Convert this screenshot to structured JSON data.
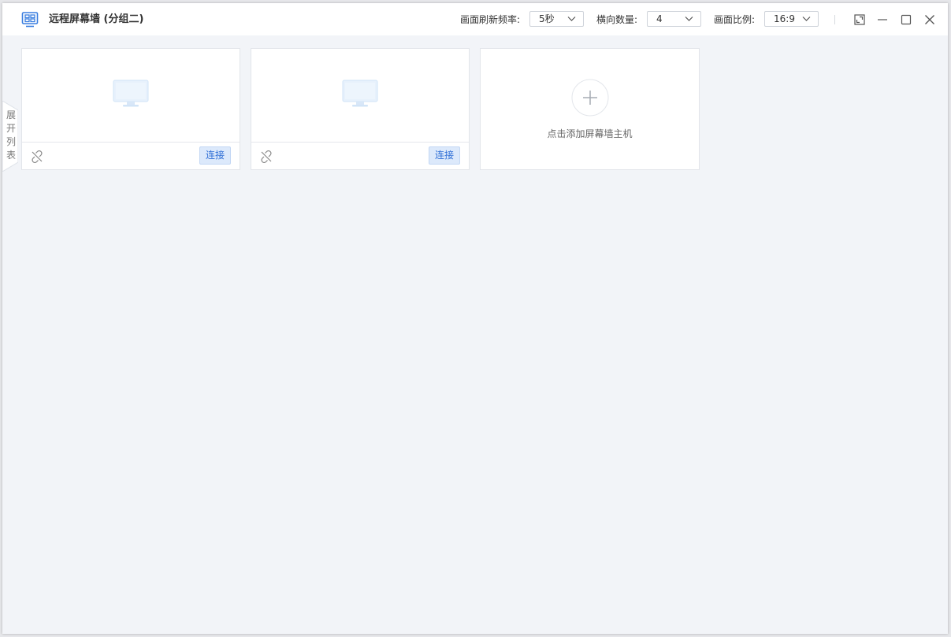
{
  "window": {
    "title": "远程屏幕墙 (分组二)"
  },
  "controls": {
    "refresh": {
      "label": "画面刷新频率:",
      "value": "5秒"
    },
    "columns": {
      "label": "横向数量:",
      "value": "4"
    },
    "ratio": {
      "label": "画面比例:",
      "value": "16:9"
    }
  },
  "side_tab": {
    "label": "展开列表"
  },
  "cards": [
    {
      "connect_label": "连接"
    },
    {
      "connect_label": "连接"
    }
  ],
  "add_card": {
    "label": "点击添加屏幕墙主机"
  },
  "colors": {
    "accent": "#2f6fd6",
    "button_bg": "#dce9fb",
    "background": "#f2f4f8",
    "card_bg": "#ffffff"
  },
  "icons": {
    "app": "screen-wall-icon",
    "disconnected": "link-broken-icon",
    "placeholder": "monitor-icon",
    "add": "plus-icon",
    "fullscreen": "fullscreen-icon",
    "minimize": "minimize-icon",
    "maximize": "maximize-icon",
    "close": "close-icon"
  }
}
